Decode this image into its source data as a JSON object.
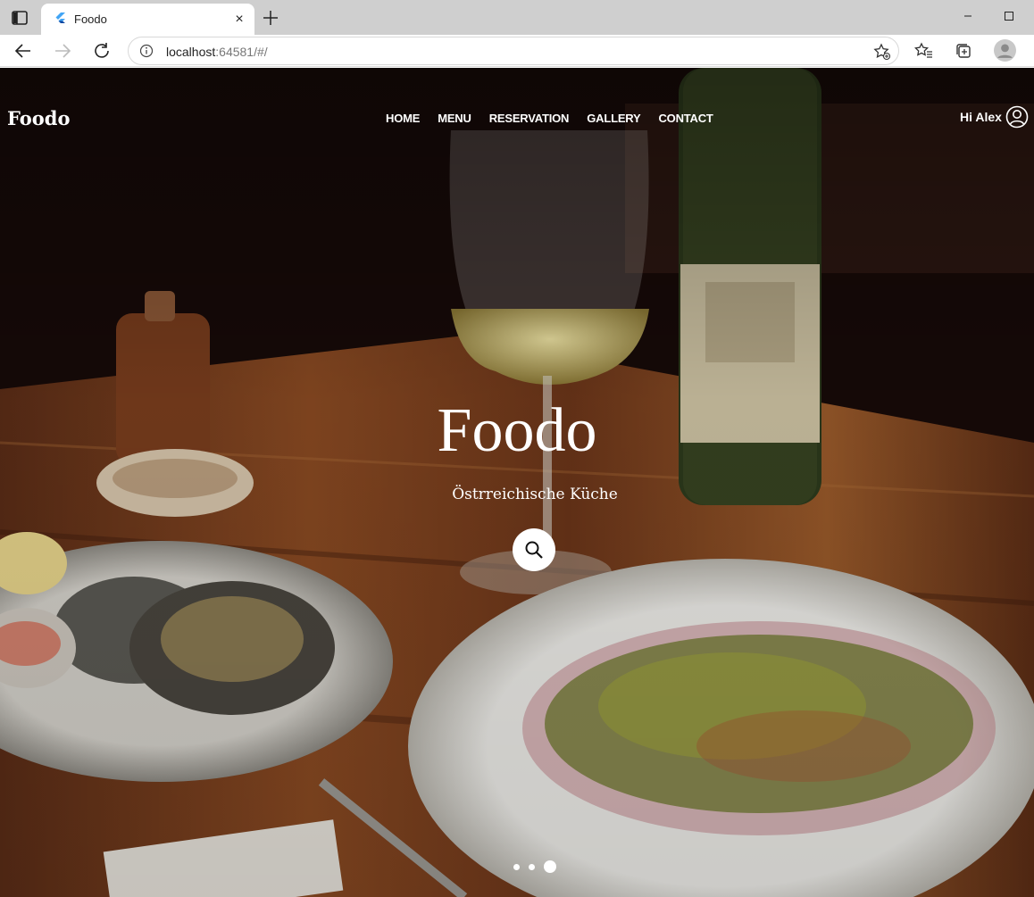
{
  "browser": {
    "tab_title": "Foodo",
    "address_host": "localhost",
    "address_rest": ":64581/#/",
    "close_glyph": "×",
    "icons": [
      "sidebar-toggle-icon",
      "flutter-favicon-icon",
      "close-icon",
      "plus-icon",
      "minimize-icon",
      "maximize-icon",
      "back-icon",
      "forward-icon",
      "refresh-icon",
      "info-icon",
      "favorite-add-icon",
      "favorites-icon",
      "collections-icon",
      "profile-icon"
    ]
  },
  "site": {
    "brand": "Foodo",
    "nav": [
      "HOME",
      "MENU",
      "RESERVATION",
      "GALLERY",
      "CONTACT"
    ],
    "greeting": "Hi Alex",
    "hero_title": "Foodo",
    "hero_subtitle": "Östrreichische Küche",
    "carousel": {
      "count": 3,
      "active_index": 2
    }
  },
  "colors": {
    "text": "#ffffff",
    "tabbar": "#cfcfcf",
    "hero_bg": "#1a0f0b"
  }
}
